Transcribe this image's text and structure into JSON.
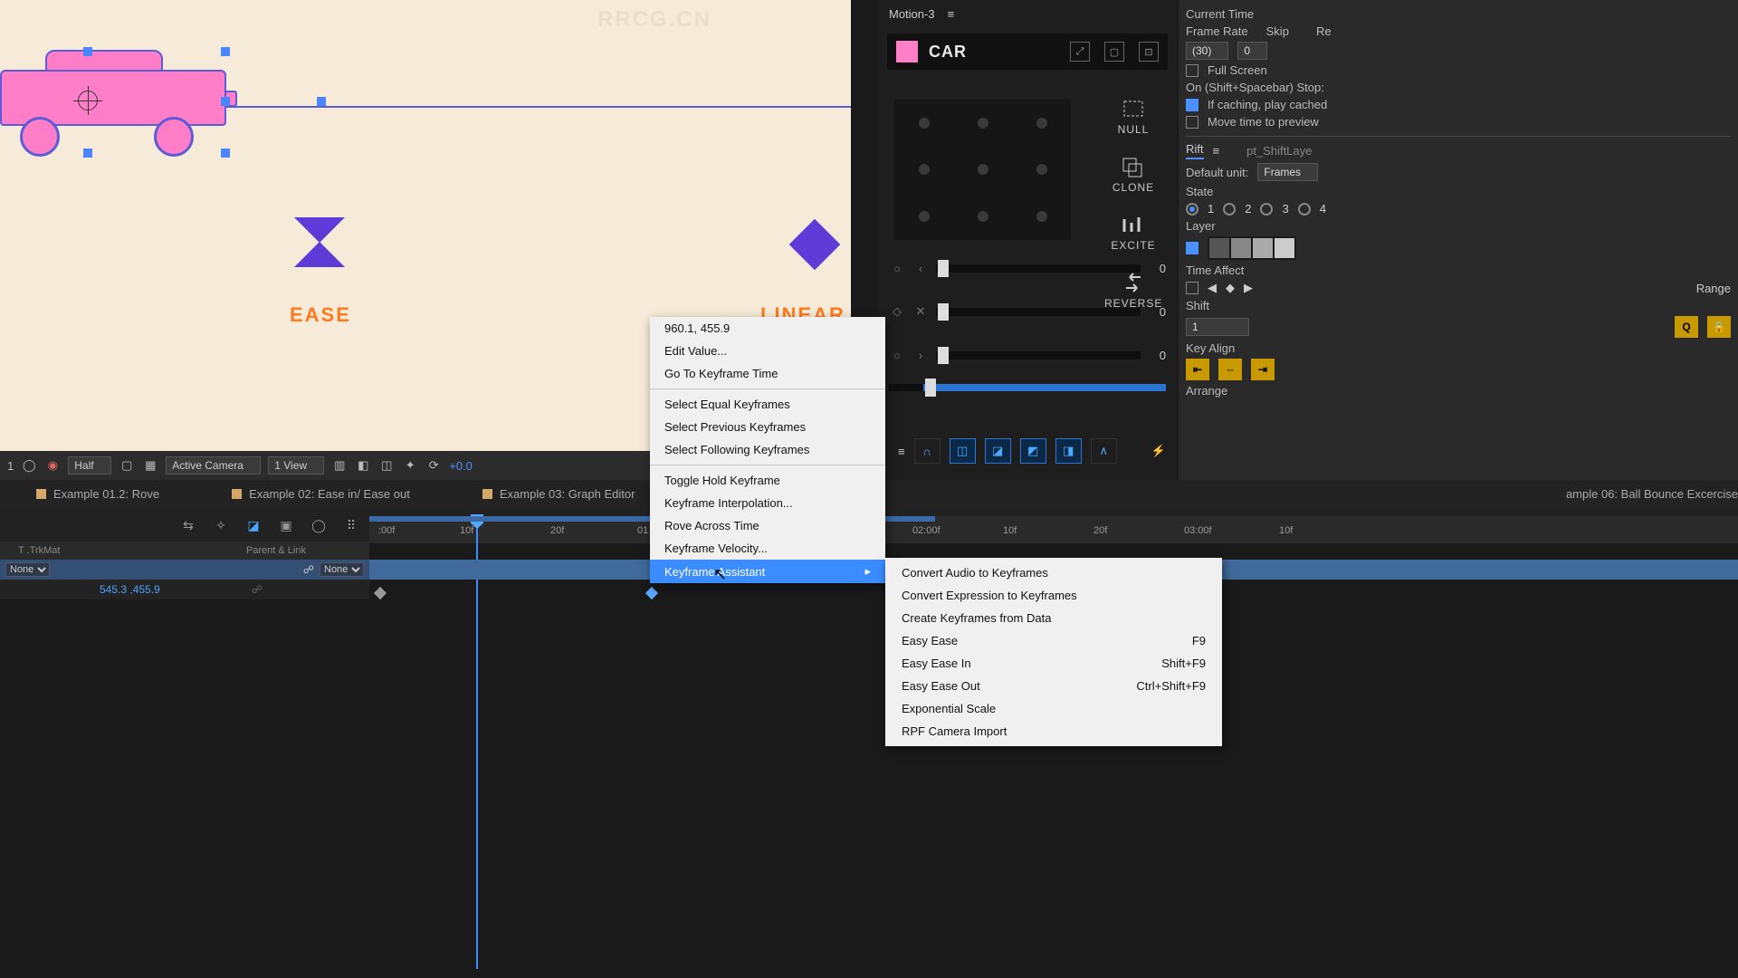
{
  "viewport": {
    "labels": {
      "ease": "EASE",
      "linear": "LINEAR"
    },
    "watermark": "RRCG.CN"
  },
  "footer": {
    "leftNum": "1",
    "resolution": "Half",
    "camera": "Active Camera",
    "views": "1 View",
    "offset": "+0.0"
  },
  "compTabs": [
    "Example 01.2: Rove",
    "Example 02: Ease in/ Ease out",
    "Example 03: Graph Editor",
    "ample 06: Ball Bounce Excercise"
  ],
  "ruler": {
    "ticks": [
      ":00f",
      "10f",
      "20f",
      "01",
      "02:00f",
      "10f",
      "20f",
      "03:00f",
      "10f"
    ]
  },
  "layerHeader": {
    "trkmat": "T .TrkMat",
    "parent": "Parent & Link"
  },
  "layer": {
    "mode": "None",
    "parent": "None"
  },
  "prop": {
    "value": "545.3 ,455.9"
  },
  "contextMenu": {
    "coords": "960.1, 455.9",
    "items": [
      "Edit Value...",
      "Go To Keyframe Time",
      "Select Equal Keyframes",
      "Select Previous Keyframes",
      "Select Following Keyframes",
      "Toggle Hold Keyframe",
      "Keyframe Interpolation...",
      "Rove Across Time",
      "Keyframe Velocity...",
      "Keyframe Assistant"
    ]
  },
  "submenu": [
    {
      "label": "Convert Audio to Keyframes",
      "shortcut": ""
    },
    {
      "label": "Convert Expression to Keyframes",
      "shortcut": ""
    },
    {
      "label": "Create Keyframes from Data",
      "shortcut": ""
    },
    {
      "label": "Easy Ease",
      "shortcut": "F9"
    },
    {
      "label": "Easy Ease In",
      "shortcut": "Shift+F9"
    },
    {
      "label": "Easy Ease Out",
      "shortcut": "Ctrl+Shift+F9"
    },
    {
      "label": "Exponential Scale",
      "shortcut": ""
    },
    {
      "label": "RPF Camera Import",
      "shortcut": ""
    }
  ],
  "motion": {
    "title": "Motion-3",
    "layerName": "CAR",
    "buttons": {
      "null": "NULL",
      "clone": "CLONE",
      "excite": "EXCITE",
      "reverse": "REVERSE"
    },
    "sliders": {
      "s1": "0",
      "s2": "0",
      "s3": "0"
    }
  },
  "rift": {
    "currentTime": "Current Time",
    "frameRate": "Frame Rate",
    "skip": "Skip",
    "re": "Re",
    "frameRateValue": "(30)",
    "skipValue": "0",
    "fullScreen": "Full Screen",
    "onStop": "On (Shift+Spacebar) Stop:",
    "ifCaching": "If caching, play cached",
    "movePreview": "Move time to preview",
    "riftTab": "Rift",
    "shiftLayerTab": "pt_ShiftLaye",
    "defaultUnit": "Default unit:",
    "defaultUnitValue": "Frames",
    "state": "State",
    "stateOptions": [
      "1",
      "2",
      "3",
      "4"
    ],
    "layer": "Layer",
    "timeAffect": "Time Affect",
    "range": "Range",
    "shift": "Shift",
    "shiftValue": "1",
    "keyAlign": "Key Align",
    "arrange": "Arrange"
  }
}
